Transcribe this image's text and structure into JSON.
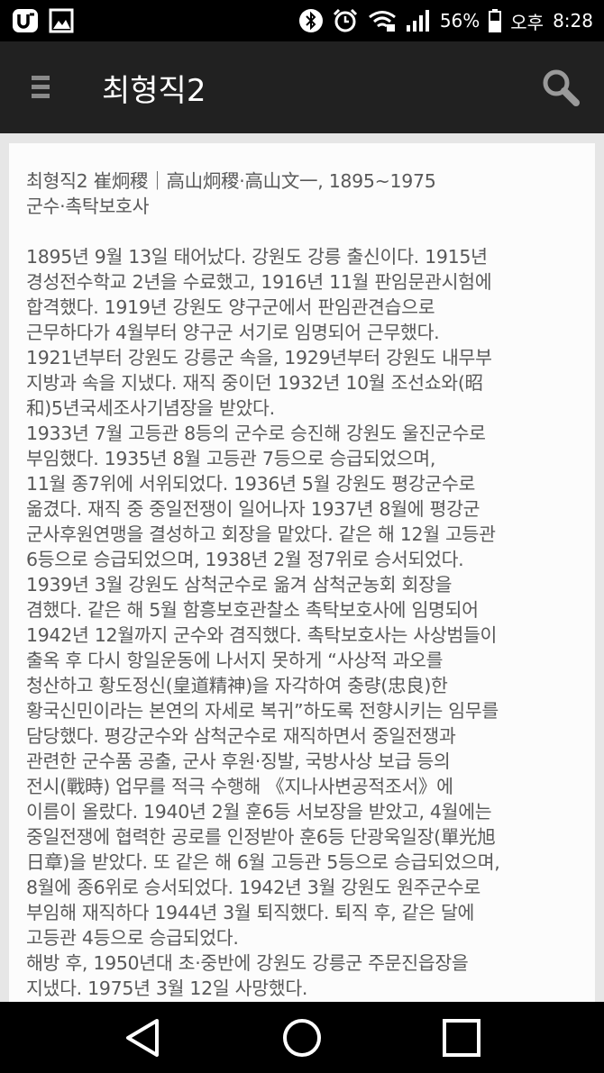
{
  "status_bar": {
    "battery_percent": "56%",
    "ampm": "오후",
    "time": "8:28"
  },
  "app_bar": {
    "title": "최형직2",
    "menu_icon": "hamburger-menu-icon",
    "search_icon": "search-icon"
  },
  "entry": {
    "header": "최형직2 崔炯稷｜高山炯稷·高山文一, 1895~1975\n군수·촉탁보호사",
    "body": "1895년 9월 13일 태어났다. 강원도 강릉 출신이다. 1915년\n경성전수학교 2년을 수료했고, 1916년 11월 판임문관시험에\n합격했다. 1919년 강원도 양구군에서 판임관견습으로\n근무하다가 4월부터 양구군 서기로 임명되어 근무했다.\n1921년부터 강원도 강릉군 속을, 1929년부터 강원도 내무부\n지방과 속을 지냈다. 재직 중이던 1932년 10월 조선쇼와(昭\n和)5년국세조사기념장을 받았다.\n1933년 7월 고등관 8등의 군수로 승진해 강원도 울진군수로\n부임했다. 1935년 8월 고등관 7등으로 승급되었으며,\n11월 종7위에 서위되었다. 1936년 5월 강원도 평강군수로\n옮겼다. 재직 중 중일전쟁이 일어나자 1937년 8월에 평강군\n군사후원연맹을 결성하고 회장을 맡았다. 같은 해 12월 고등관\n6등으로 승급되었으며, 1938년 2월 정7위로 승서되었다.\n1939년 3월 강원도 삼척군수로 옮겨 삼척군농회 회장을\n겸했다. 같은 해 5월 함흥보호관찰소 촉탁보호사에 임명되어\n1942년 12월까지 군수와 겸직했다. 촉탁보호사는 사상범들이\n출옥 후 다시 항일운동에 나서지 못하게 “사상적 과오를\n청산하고 황도정신(皇道精神)을 자각하여 충량(忠良)한\n황국신민이라는 본연의 자세로 복귀”하도록 전향시키는 임무를\n담당했다. 평강군수와 삼척군수로 재직하면서 중일전쟁과\n관련한 군수품 공출, 군사 후원·징발, 국방사상 보급 등의\n전시(戰時) 업무를 적극 수행해 《지나사변공적조서》에\n이름이 올랐다. 1940년 2월 훈6등 서보장을 받았고, 4월에는\n중일전쟁에 협력한 공로를 인정받아 훈6등 단광욱일장(單光旭\n日章)을 받았다. 또 같은 해 6월 고등관 5등으로 승급되었으며,\n8월에 종6위로 승서되었다. 1942년 3월 강원도 원주군수로\n부임해 재직하다 1944년 3월 퇴직했다. 퇴직 후, 같은 달에\n고등관 4등으로 승급되었다.\n해방 후, 1950년대 초·중반에 강원도 강릉군 주문진읍장을\n지냈다. 1975년 3월 12일 사망했다."
  },
  "nav_bar": {
    "back_icon": "back-triangle-icon",
    "home_icon": "home-circle-icon",
    "recent_icon": "recent-apps-square-icon"
  }
}
